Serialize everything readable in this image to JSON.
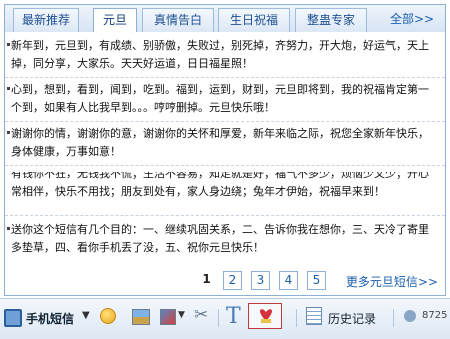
{
  "tabs": [
    {
      "label": "最新推荐",
      "active": false
    },
    {
      "label": "元旦",
      "active": true
    },
    {
      "label": "真情告白",
      "active": false
    },
    {
      "label": "生日祝福",
      "active": false
    },
    {
      "label": "整蛊专家",
      "active": false
    }
  ],
  "tabs_more": "全部>>",
  "messages": [
    "新年到，元旦到，有成绩、别骄傲，失败过，别死掉，齐努力，开大炮，好运气，天上掉，同分享，大家乐。天天好运道，日日福星照！",
    "心到，想到，看到，闻到，吃到。福到，运到，财到，元旦即将到，我的祝福肯定第一个到，如果有人比我早到。。。哼哼删掉。元旦快乐哦！",
    "谢谢你的情，谢谢你的意，谢谢你的关怀和厚爱，新年来临之际，祝您全家新年快乐，身体健康，万事如意！",
    "有钱你不狂，无钱我不慌；生活不容易，知足就是好；福气不多少，烦恼少又少；开心常相伴，快乐不用找；朋友到处有，家人身边绕；兔年才伊始，祝福早来到！",
    "送你这个短信有几个目的：一、继续巩固关系，二、告诉你我在想你，三、天冷了寄里多垫草，四、看你手机丢了没，五、祝你元旦快乐！"
  ],
  "pager": {
    "pages": [
      "1",
      "2",
      "3",
      "4",
      "5"
    ],
    "current": "1",
    "more": "更多元旦短信>>"
  },
  "toolbar": {
    "phone_label": "手机短信",
    "dropdown_arrow": "▼",
    "history_label": "历史记录",
    "count": "8725"
  },
  "icons": {
    "phone": "phone-icon",
    "emoticon": "smile-icon",
    "image": "image-icon",
    "screenshot": "screenshot-icon",
    "scissors": "scissors-icon",
    "font": "font-icon",
    "gift": "gift-icon",
    "history": "history-icon",
    "qq": "qq-icon"
  }
}
